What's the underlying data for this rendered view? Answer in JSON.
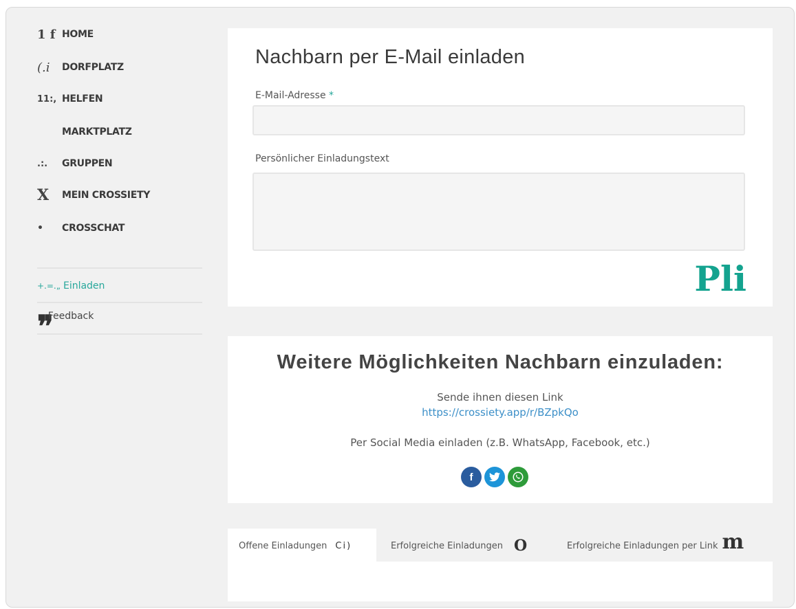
{
  "sidebar": {
    "nav": [
      {
        "icon_glyph": "1 f",
        "icon": "home-icon",
        "label": "HOME"
      },
      {
        "icon_glyph": "(.i",
        "icon": "village-square-icon",
        "label": "DORFPLATZ"
      },
      {
        "icon_glyph": "11:,",
        "icon": "help-icon",
        "label": "HELFEN"
      },
      {
        "icon_glyph": "",
        "icon": "market-icon",
        "label": "MARKTPLATZ"
      },
      {
        "icon_glyph": ".:.",
        "icon": "groups-icon",
        "label": "GRUPPEN"
      },
      {
        "icon_glyph": "X",
        "icon": "profile-icon",
        "label": "MEIN CROSSIETY"
      },
      {
        "icon_glyph": "•",
        "icon": "chat-icon",
        "label": "CROSSCHAT"
      }
    ],
    "invite": {
      "icon_glyph": "+.=.„",
      "label": "Einladen"
    },
    "feedback": {
      "icon_glyph": "❞",
      "label": "Feedback"
    }
  },
  "invite_form": {
    "title": "Nachbarn per E-Mail einladen",
    "email_label": "E-Mail-Adresse",
    "required_mark": "*",
    "email_value": "",
    "message_label": "Persönlicher Einladungstext",
    "message_value": "",
    "send_glyph": "Pli"
  },
  "more_options": {
    "heading": "Weitere Möglichkeiten Nachbarn einzuladen:",
    "send_link_text": "Sende ihnen diesen Link",
    "link": "https://crossiety.app/r/BZpkQo",
    "social_text": "Per Social Media einladen (z.B. WhatsApp, Facebook, etc.)",
    "social": [
      {
        "icon": "facebook-icon",
        "glyph": "f",
        "color": "#2a5c9e"
      },
      {
        "icon": "twitter-icon",
        "glyph": "t",
        "color": "#1d94d8"
      },
      {
        "icon": "whatsapp-icon",
        "glyph": "✆",
        "color": "#2e9b3a"
      }
    ]
  },
  "tabs": [
    {
      "label": "Offene Einladungen",
      "count": "Ci)"
    },
    {
      "label": "Erfolgreiche Einladungen",
      "count": "O"
    },
    {
      "label": "Erfolgreiche Einladungen per Link",
      "count": "m"
    }
  ],
  "colors": {
    "accent": "#27a79b",
    "link": "#3c8fc8"
  }
}
